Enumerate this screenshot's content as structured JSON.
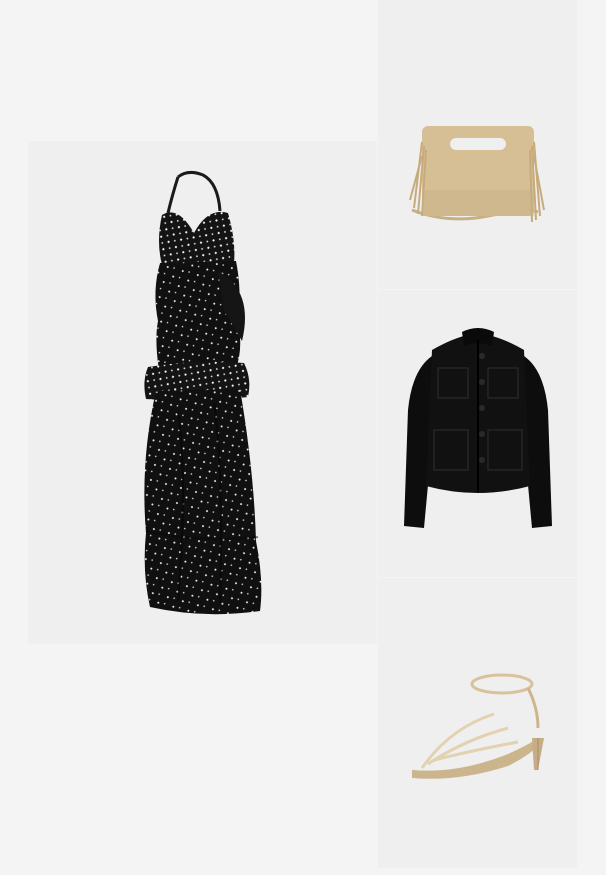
{
  "outfit": {
    "items": [
      {
        "product": "dress",
        "icon": "halter-maxi-dress-image"
      },
      {
        "product": "bag",
        "icon": "fringe-suede-bag-image"
      },
      {
        "product": "jacket",
        "icon": "black-cropped-jacket-image"
      },
      {
        "product": "shoe",
        "icon": "metallic-strappy-sandal-image"
      }
    ]
  },
  "colors": {
    "page_background": "#f4f4f4",
    "tile_background": "#efefef",
    "dress_fabric": "#111111",
    "bag_suede": "#d6bf95",
    "jacket_fabric": "#0d0d0d",
    "sandal_metal": "#d9c6a3"
  }
}
